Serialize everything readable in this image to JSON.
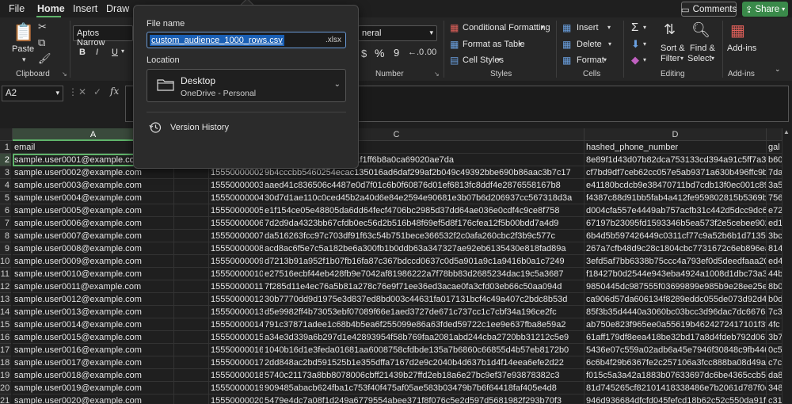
{
  "menubar": {
    "items": [
      "File",
      "Home",
      "Insert",
      "Draw"
    ],
    "comments_label": "Comments",
    "share_label": "Share",
    "accent": "#5fb36a",
    "share_color": "#3a8a4a"
  },
  "ribbon": {
    "clipboard": {
      "paste_label": "Paste",
      "group_label": "Clipboard"
    },
    "font": {
      "font_name": "Aptos Narrow",
      "bold": "B",
      "italic": "I",
      "underline": "U"
    },
    "number": {
      "format_partial": "neral",
      "percent": "%",
      "comma": "9",
      "group_label": "Number"
    },
    "styles": {
      "conditional_formatting": "Conditional Formatting",
      "format_as_table": "Format as Table",
      "cell_styles": "Cell Styles",
      "group_label": "Styles"
    },
    "cells": {
      "insert": "Insert",
      "delete": "Delete",
      "format": "Format",
      "group_label": "Cells"
    },
    "editing": {
      "sum_symbol": "Σ",
      "sort_filter_line1": "Sort &",
      "sort_filter_line2": "Filter",
      "find_select_line1": "Find &",
      "find_select_line2": "Select",
      "group_label": "Editing"
    },
    "addins": {
      "label": "Add-ins",
      "group_label": "Add-ins"
    }
  },
  "formula_bar": {
    "name_box": "A2",
    "fx": "fx",
    "formula": ""
  },
  "popup": {
    "file_name_label": "File name",
    "file_name": "custom_audience_1000_rows.csv",
    "file_ext": ".xlsx",
    "location_label": "Location",
    "location_name": "Desktop",
    "location_sub": "OneDrive - Personal",
    "version_history": "Version History"
  },
  "grid": {
    "columns": [
      "A",
      "B",
      "C",
      "D",
      "E"
    ],
    "header_row": [
      "email",
      "",
      "",
      "hashed_phone_number",
      "gal"
    ],
    "rows": [
      {
        "n": "2",
        "email": "sample.user0001@example.com",
        "phone": "",
        "hash_c": "c94aadfc512f1ec083301f1ff6b8a0ca69020ae7da",
        "hash_d": "8e89f1d43d07b82dca753133cd394a91c5ff7a30f",
        "e": "b60"
      },
      {
        "n": "3",
        "email": "sample.user0002@example.com",
        "phone": "15550000002",
        "hash_c": "9b4cccbb5460254ecac135016ad6daf299af2b049c49392bbe690b86aac3b7c17",
        "hash_d": "cf7bd9df7ceb62cc057e5ab9371a630b496ffc9b07",
        "e": "7da"
      },
      {
        "n": "4",
        "email": "sample.user0003@example.com",
        "phone": "15550000003",
        "hash_c": "aaed41c836506c4487e0d7f01c6b0f60876d01ef6813fc8ddf4e2876558167b8",
        "hash_d": "e41180bcdcb9e38470711bd7cdb13f0ec001c895",
        "e": "3a5"
      },
      {
        "n": "5",
        "email": "sample.user0004@example.com",
        "phone": "15550000004",
        "hash_c": "30d7d1ae110c0ced45b2a40d6e84e2594e90681e3b07b6d206937cc567318d3a",
        "hash_d": "f4387c88d91bb5fab4a412fe959802815b5369bd",
        "e": "756"
      },
      {
        "n": "6",
        "email": "sample.user0005@example.com",
        "phone": "15550000005",
        "hash_c": "e1f154ce05e48805da6dd64fecf4706bc2985d37dd64ae036e0cdf4c9ce8f758",
        "hash_d": "d004cfa557e4449ab757acfb31c442d5dcc9dc63",
        "e": "e72"
      },
      {
        "n": "7",
        "email": "sample.user0006@example.com",
        "phone": "15550000006",
        "hash_c": "7d2d9da4323bb67cfdb0ec56d2b516b48f69ef5d8f176cfea12f5b00bdd7a4d9",
        "hash_d": "67197b23095fd1593346b5ea573f2e5cebee902fc",
        "e": "ed1"
      },
      {
        "n": "8",
        "email": "sample.user0007@example.com",
        "phone": "15550000007",
        "hash_c": "da516263fcc97c703df91f63c54b751bece366532f2c0afa260cbc2f3b9c577c",
        "hash_d": "6b4d5b597426449c0311cf77c9a52b6b1d7135f1",
        "e": "3bc"
      },
      {
        "n": "9",
        "email": "sample.user0008@example.com",
        "phone": "15550000008",
        "hash_c": "acd8ac6f5e7c5a182be6a300fb1b0ddb63a347327ae92eb6135430e818fad89a",
        "hash_d": "267a7cfb48d9c28c1804cbc7731672c6eb896eac",
        "e": "814"
      },
      {
        "n": "10",
        "email": "sample.user0009@example.com",
        "phone": "15550000009",
        "hash_c": "d7213b91a952f1b07fb16fa87c367bdccd0637c0d5a901a9c1a9416b0a1c7249",
        "hash_d": "3efd5af7bb6338b75ccc4a793ef0d5deedfaaa20c",
        "e": "ed4"
      },
      {
        "n": "11",
        "email": "sample.user0010@example.com",
        "phone": "15550000010",
        "hash_c": "e27516ecbf44eb428fb9e7042af81986222a7f78bb83d2685234dac19c5a3687",
        "hash_d": "f18427b0d2544e943eba4924a1008d1dbc73a3d7f",
        "e": "44b"
      },
      {
        "n": "12",
        "email": "sample.user0011@example.com",
        "phone": "15550000011",
        "hash_c": "7f285d11e4ec76a5b81a278c76e9f71ee36ed3acae0fa3cfd03eb66c50aa094d",
        "hash_d": "9850445dc987555f03699899e985b9e28ee25eaf",
        "e": "8b0"
      },
      {
        "n": "13",
        "email": "sample.user0012@example.com",
        "phone": "15550000012",
        "hash_c": "30b7770dd9d1975e3d837ed8bd003c44631fa017131bcf4c49a407c2bdc8b53d",
        "hash_d": "ca906d57da606134f8289eddc055de073d92d498",
        "e": "b0d"
      },
      {
        "n": "14",
        "email": "sample.user0013@example.com",
        "phone": "15550000013",
        "hash_c": "d5e9982ff4b73053ebf07089f66e1aed3727de671c737cc1c7cbf34a196ce2fc",
        "hash_d": "85f3b35d4440a3060bc03bcc3d96dac7dc6676a",
        "e": "7c3"
      },
      {
        "n": "15",
        "email": "sample.user0014@example.com",
        "phone": "15550000014",
        "hash_c": "791c37871adee1c68b4b5ea6f255099e86a63fded59722c1ee9e637fba8e59a2",
        "hash_d": "ab750e823f965ee0a55619b4624272417101f3f7f31",
        "e": "4fc"
      },
      {
        "n": "16",
        "email": "sample.user0015@example.com",
        "phone": "15550000015",
        "hash_c": "a34e3d339a6b297d1e42893954f58b769faa2081abd244cba2720bb31212c5e9",
        "hash_d": "61aff179df8eea418be32bd17a8d4fdeb792d0676",
        "e": "3b7"
      },
      {
        "n": "17",
        "email": "sample.user0016@example.com",
        "phone": "15550000016",
        "hash_c": "1040b16d1e3feda01681aa6008758cfdbde135a7b6860c66855d4b57eb8172b0",
        "hash_d": "5436e07c559a02adb6a45e7946f30848c9fb446b",
        "e": "0c5"
      },
      {
        "n": "18",
        "email": "sample.user0017@example.com",
        "phone": "15550000017",
        "hash_c": "2dd848ac2bd591525b1e355dffa7167d2e9c2040b4d637b1d4f14eea6efe2d22",
        "hash_d": "6c6b4f29b6367fe2c257106a3fcc888ba08d49a7",
        "e": "c7c"
      },
      {
        "n": "19",
        "email": "sample.user0018@example.com",
        "phone": "15550000018",
        "hash_c": "5740c21173a8bb8078006cbff21439b27ffd2eb18a6e27bc9ef37e93878382c3",
        "hash_d": "f015c5a3a42a1883b07633697dc6be4365ccb57",
        "e": "da8"
      },
      {
        "n": "20",
        "email": "sample.user0019@example.com",
        "phone": "15550000019",
        "hash_c": "909485abacb624fba1c753f40f475af05ae583b03479b7b6f64418faf405e4d8",
        "hash_d": "81d745265cf82101418338486e7b2061d787f0cb",
        "e": "348"
      },
      {
        "n": "21",
        "email": "sample.user0020@example.com",
        "phone": "15550000020",
        "hash_c": "5479e4dc7a08f1d249a6779554abee371f8f076c5e2d597d5681982f293b70f3",
        "hash_d": "946d936684dfcfd045fefcd18b62c52c550da91f7",
        "e": "c31"
      },
      {
        "n": "22",
        "email": "sample.user0021@example.com",
        "phone": "15550000021",
        "hash_c": "c276bc824522d03784c573e249129347463ea629789cc125626d680dff608319b",
        "hash_d": "fc5773c748c85c176ebb5e0292fe9efdd0573400",
        "e": "a26"
      }
    ]
  }
}
